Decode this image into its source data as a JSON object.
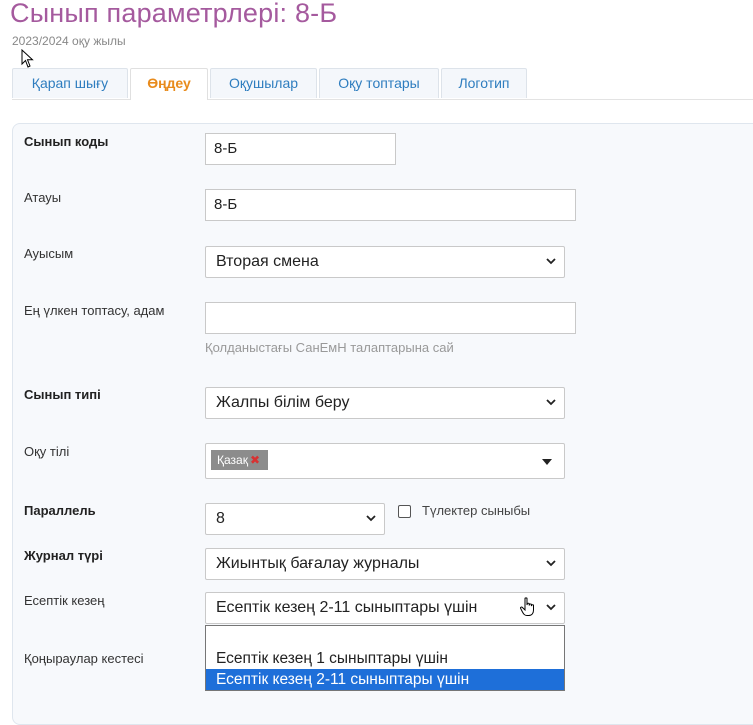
{
  "page": {
    "title": "Сынып параметрлері: 8-Б",
    "subtitle": "2023/2024 оқу жылы"
  },
  "tabs": [
    {
      "label": "Қарап шығу",
      "active": false
    },
    {
      "label": "Өңдеу",
      "active": true
    },
    {
      "label": "Оқушылар",
      "active": false
    },
    {
      "label": "Оқу топтары",
      "active": false
    },
    {
      "label": "Логотип",
      "active": false
    }
  ],
  "form": {
    "class_code": {
      "label": "Сынып коды",
      "value": "8-Б"
    },
    "name": {
      "label": "Атауы",
      "value": "8-Б"
    },
    "shift": {
      "label": "Ауысым",
      "value": "Вторая смена"
    },
    "max_group": {
      "label": "Ең үлкен топтасу, адам",
      "value": "",
      "hint": "Қолданыстағы СанЕмН талаптарына сай"
    },
    "class_type": {
      "label": "Сынып типі",
      "value": "Жалпы білім беру"
    },
    "language": {
      "label": "Оқу тілі",
      "tags": [
        "Қазақ"
      ],
      "remove_glyph": "✖"
    },
    "parallel": {
      "label": "Параллель",
      "value": "8",
      "graduates_label": "Түлектер сыныбы",
      "graduates_checked": false
    },
    "journal_type": {
      "label": "Журнал түрі",
      "value": "Жиынтық бағалау журналы"
    },
    "report_period": {
      "label": "Есептік кезең",
      "value": "Есептік кезең 2-11 сыныптары үшін",
      "options": [
        "",
        "Есептік кезең 1 сыныптары үшін",
        "Есептік кезең 2-11 сыныптары үшін"
      ],
      "selected_index": 2
    },
    "bell_schedule": {
      "label": "Қоңыраулар кестесі"
    }
  },
  "colors": {
    "title": "#a55a9e",
    "tab_link": "#2e7dbf",
    "tab_active": "#e88b1c",
    "selected_option": "#1e6fd9"
  }
}
